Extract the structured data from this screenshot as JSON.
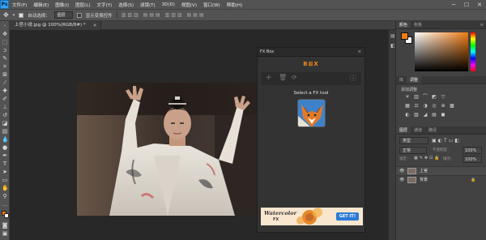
{
  "app": {
    "logo": "Ps"
  },
  "menu": [
    "文件(F)",
    "编辑(E)",
    "图像(I)",
    "图层(L)",
    "文字(Y)",
    "选择(S)",
    "滤镜(T)",
    "3D(D)",
    "视图(V)",
    "窗口(W)",
    "帮助(H)"
  ],
  "window_controls": {
    "minimize": "─",
    "maximize": "☐",
    "close": "✕"
  },
  "options": {
    "auto_select_label": "自动选择：",
    "layer_select": "图层",
    "show_transform_label": "显示变换控件"
  },
  "document_tab": {
    "title": "上官小说.jpg @ 100%(RGB/8#) *",
    "close": "×"
  },
  "fx_panel": {
    "title": "FX Box",
    "logo": "B⊠X",
    "prompt": "Select a FX tool",
    "banner": {
      "line1": "Watercolor",
      "line2": "FX",
      "cta": "GET IT!"
    }
  },
  "right_panel": {
    "color_tabs": [
      "颜色",
      "色板"
    ],
    "adjust_tabs": [
      "库",
      "调整"
    ],
    "adjust_add_label": "添加调整",
    "layers_tabs": [
      "图层",
      "通道",
      "路径"
    ],
    "filter_kind": "类型",
    "blend_mode": "正常",
    "opacity_label": "不透明度：",
    "opacity_value": "100%",
    "lock_label": "锁定：",
    "fill_label": "填充：",
    "fill_value": "100%",
    "layers": [
      {
        "name": "上官"
      },
      {
        "name": "背景"
      }
    ],
    "colors": {
      "foreground": "#f07d14",
      "background": "#ffffff"
    }
  }
}
